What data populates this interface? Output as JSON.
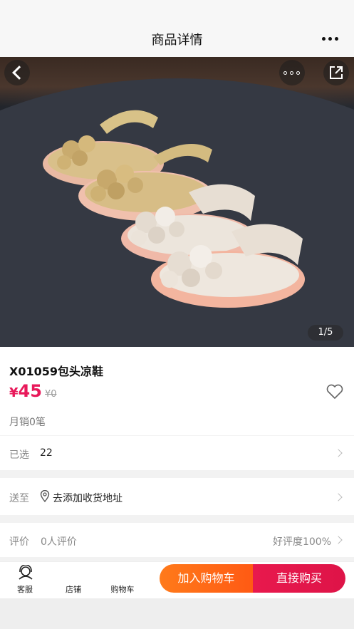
{
  "nav": {
    "title": "商品详情"
  },
  "gallery": {
    "counter": "1/5"
  },
  "product": {
    "title": "X01059包头凉鞋",
    "currency": "¥",
    "price": "45",
    "original_price": "¥0",
    "sales": "月销0笔"
  },
  "selected": {
    "label": "已选",
    "value": "22"
  },
  "shipping": {
    "label": "送至",
    "value": "去添加收货地址"
  },
  "reviews": {
    "label": "评价",
    "value": "0人评价",
    "rating": "好评度100%"
  },
  "tabbar": {
    "service": "客服",
    "store": "店铺",
    "cart": "购物车",
    "add_to_cart": "加入购物车",
    "buy_now": "直接购买"
  },
  "colors": {
    "accent": "#e8195a",
    "cart_button": "#ff6a16",
    "buy_button": "#e3174b"
  },
  "icons": [
    "back-icon",
    "more-dots-icon",
    "share-icon",
    "heart-icon",
    "location-pin-icon",
    "customer-service-icon",
    "chevron-right-icon"
  ]
}
